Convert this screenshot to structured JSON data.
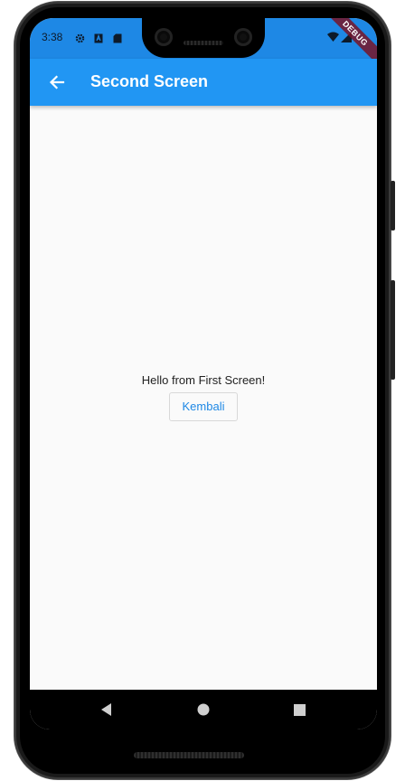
{
  "status_bar": {
    "time": "3:38",
    "color": "#1e88e5"
  },
  "debug_banner": {
    "label": "DEBUG"
  },
  "app_bar": {
    "title": "Second Screen",
    "back_icon": "arrow-back-icon",
    "color": "#2196f3"
  },
  "content": {
    "message": "Hello from First Screen!",
    "button_label": "Kembali"
  },
  "nav_bar": {
    "back_icon": "triangle-back-icon",
    "home_icon": "circle-home-icon",
    "recents_icon": "square-recents-icon"
  }
}
